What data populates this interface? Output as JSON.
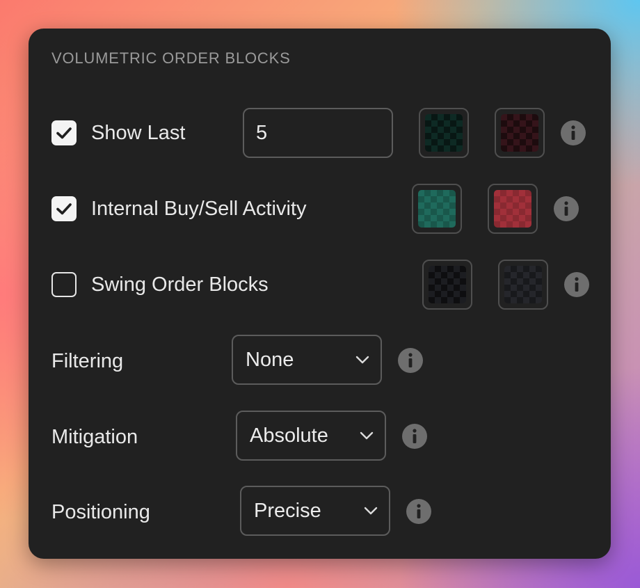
{
  "panel": {
    "title": "VOLUMETRIC ORDER BLOCKS"
  },
  "rows": {
    "show_last": {
      "label": "Show Last",
      "checked": true,
      "value": "5",
      "swatches": [
        "dark-teal-transparent",
        "dark-red-transparent"
      ],
      "swatch_colors": [
        "#0e2a24",
        "#35141a"
      ]
    },
    "internal": {
      "label": "Internal Buy/Sell Activity",
      "checked": true,
      "swatches": [
        "teal",
        "red"
      ],
      "swatch_colors": [
        "#1f6a5c",
        "#a1303a"
      ]
    },
    "swing": {
      "label": "Swing Order Blocks",
      "checked": false,
      "swatches": [
        "dark-gray-transparent",
        "dark-gray-transparent"
      ],
      "swatch_colors": [
        "#1c1d21",
        "#25262b"
      ]
    },
    "filtering": {
      "label": "Filtering",
      "value": "None"
    },
    "mitigation": {
      "label": "Mitigation",
      "value": "Absolute"
    },
    "positioning": {
      "label": "Positioning",
      "value": "Precise"
    }
  },
  "icons": {
    "check": "checkmark-icon",
    "info": "info-icon",
    "chevron": "chevron-down-icon"
  }
}
